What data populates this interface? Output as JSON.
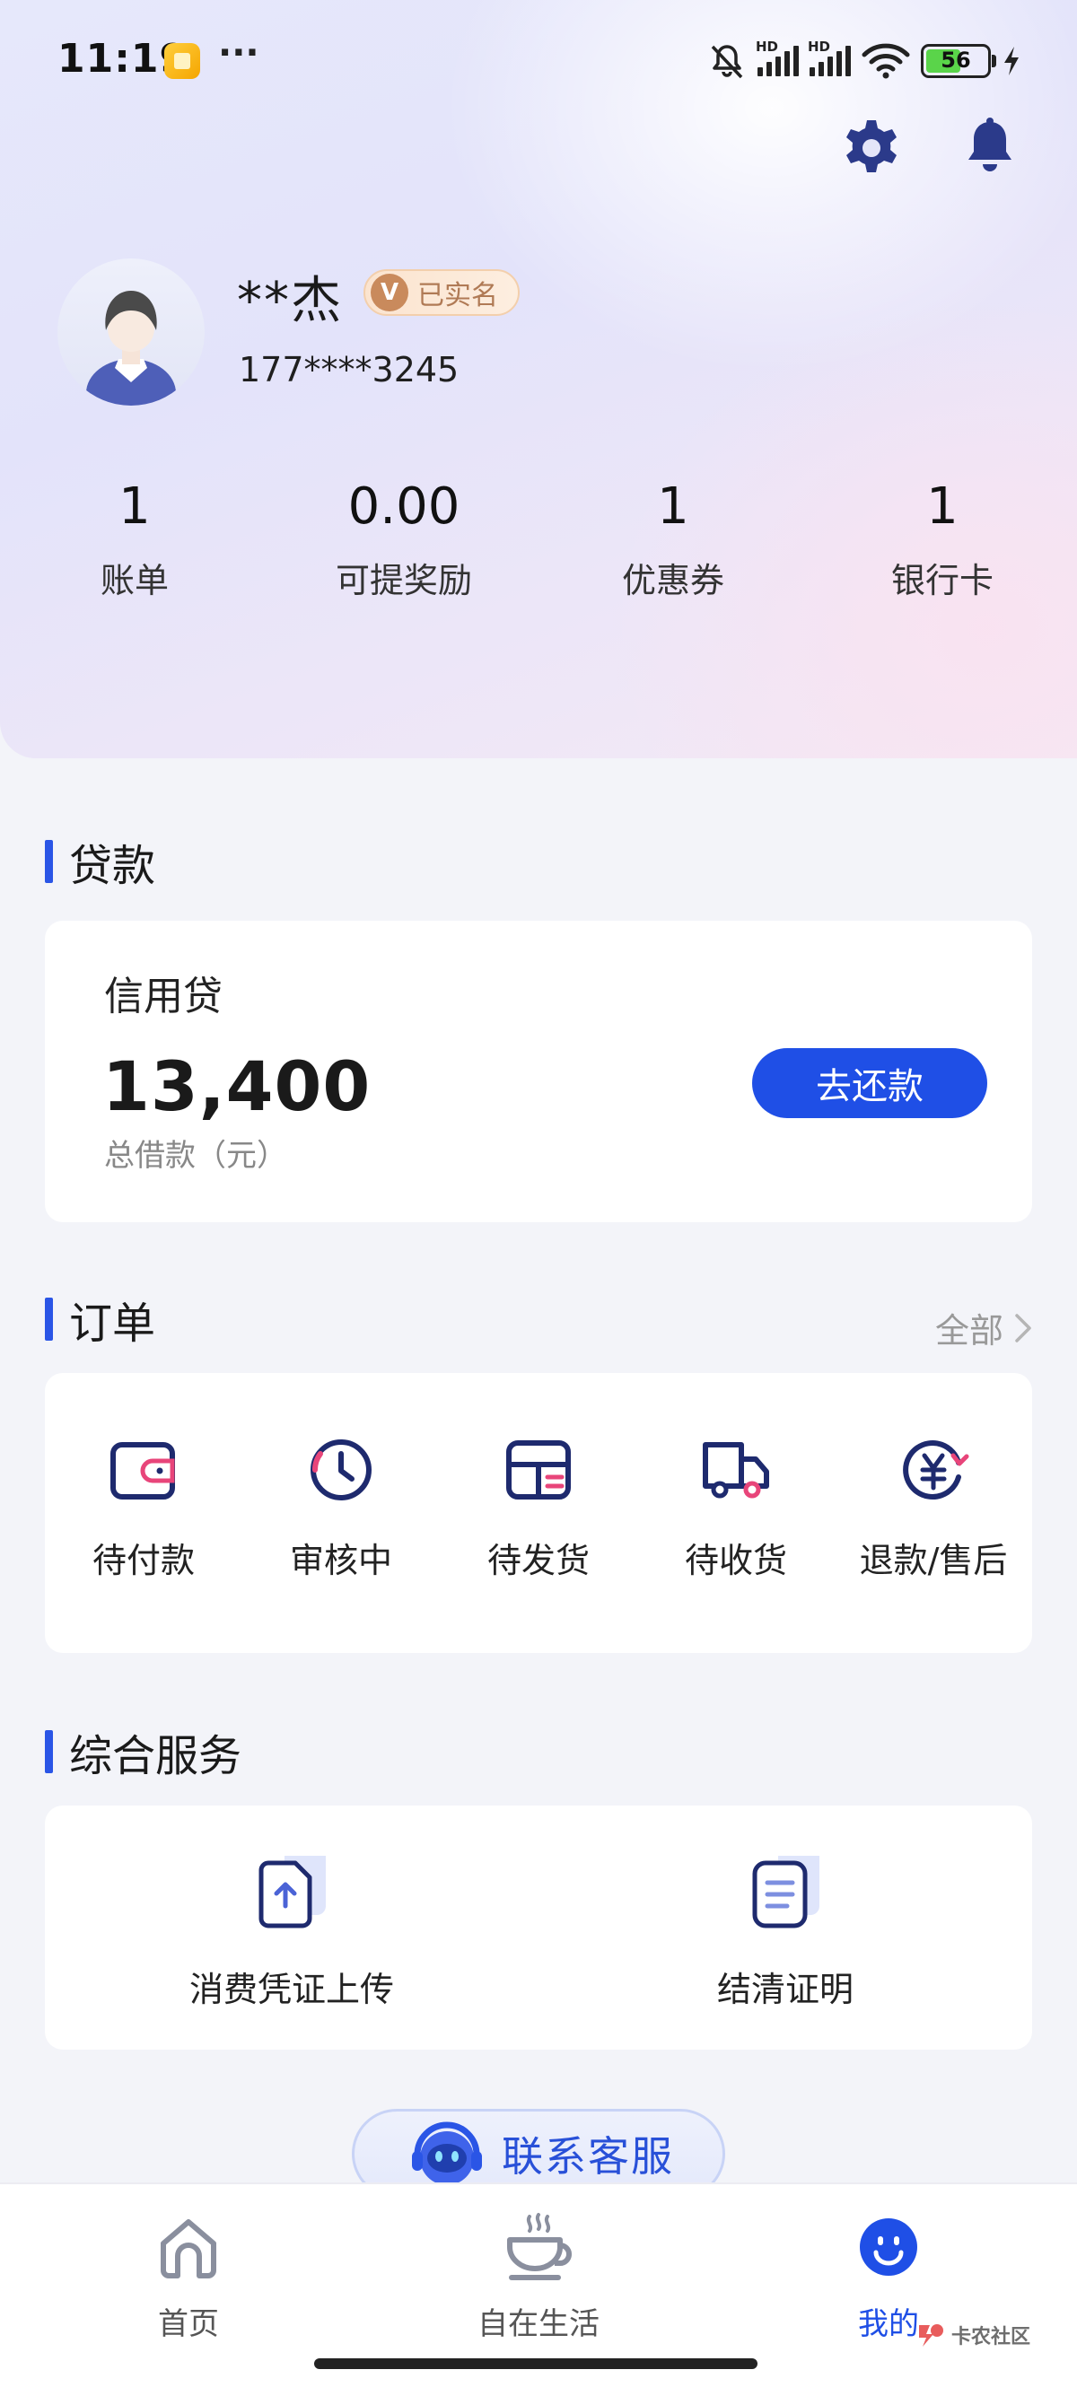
{
  "status_bar": {
    "time": "11:19",
    "more": "···",
    "battery": "56",
    "hd1": "HD",
    "hd2": "HD"
  },
  "profile": {
    "name": "**杰",
    "verified_badge": "V",
    "verified_label": "已实名",
    "phone": "177****3245"
  },
  "stats": [
    {
      "value": "1",
      "label": "账单"
    },
    {
      "value": "0.00",
      "label": "可提奖励"
    },
    {
      "value": "1",
      "label": "优惠券"
    },
    {
      "value": "1",
      "label": "银行卡"
    }
  ],
  "loan": {
    "section_title": "贷款",
    "product_name": "信用贷",
    "amount": "13,400",
    "amount_label": "总借款（元）",
    "repay_button": "去还款"
  },
  "orders": {
    "section_title": "订单",
    "all_label": "全部",
    "items": [
      {
        "label": "待付款",
        "icon": "wallet-icon"
      },
      {
        "label": "审核中",
        "icon": "clock-icon"
      },
      {
        "label": "待发货",
        "icon": "package-icon"
      },
      {
        "label": "待收货",
        "icon": "truck-icon"
      },
      {
        "label": "退款/售后",
        "icon": "refund-icon"
      }
    ]
  },
  "services": {
    "section_title": "综合服务",
    "items": [
      {
        "label": "消费凭证上传",
        "icon": "upload-document-icon"
      },
      {
        "label": "结清证明",
        "icon": "certificate-document-icon"
      }
    ],
    "contact_button": "联系客服"
  },
  "bottom_nav": {
    "items": [
      {
        "label": "首页",
        "icon": "home-icon",
        "active": false
      },
      {
        "label": "自在生活",
        "icon": "coffee-cup-icon",
        "active": false
      },
      {
        "label": "我的",
        "icon": "smiley-icon",
        "active": true
      }
    ]
  },
  "watermark": "卡农社区",
  "colors": {
    "accent": "#1f4fe6",
    "section_bar": "#2a55e6",
    "verified_brown": "#c98a5c"
  }
}
